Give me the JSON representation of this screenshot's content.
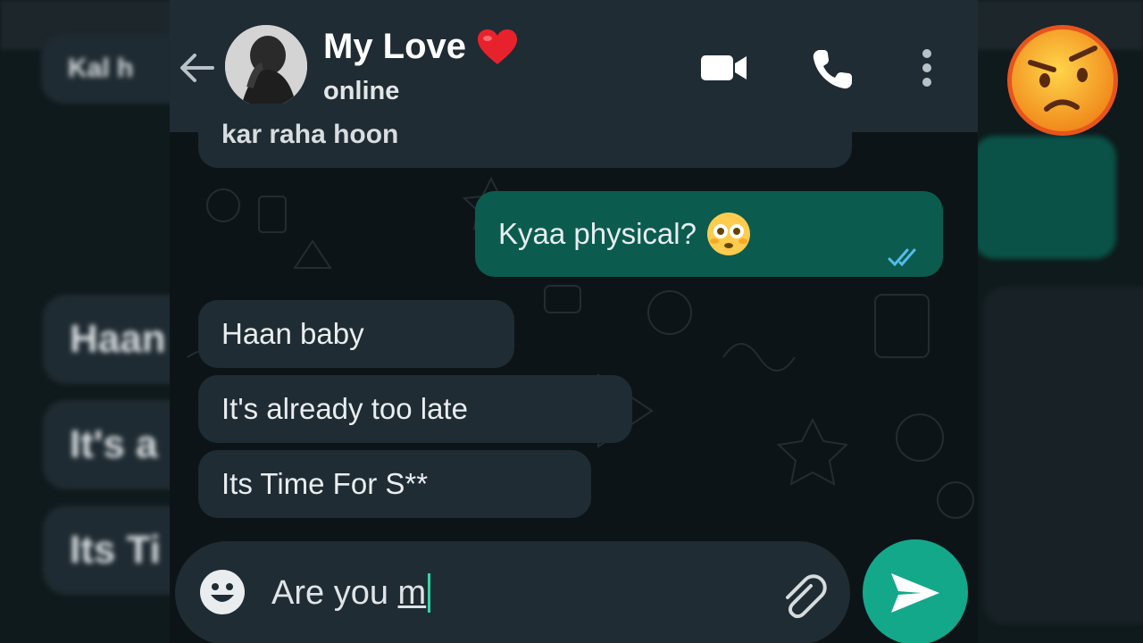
{
  "header": {
    "contact_name": "My Love",
    "status": "online"
  },
  "messages": [
    {
      "direction": "in",
      "text": "kar raha hoon"
    },
    {
      "direction": "out",
      "text": "Kyaa physical?",
      "emoji": "flushed-face",
      "read": true
    },
    {
      "direction": "in",
      "text": "Haan baby"
    },
    {
      "direction": "in",
      "text": "It's already too late"
    },
    {
      "direction": "in",
      "text": "Its Time For S**"
    }
  ],
  "composer": {
    "typed_prefix": "Are you ",
    "typed_tail": "m"
  },
  "background": {
    "blurred_top": "Kal h",
    "blurred_1": "Haan",
    "blurred_2": "It's a",
    "blurred_3": "Its Ti"
  },
  "colors": {
    "incoming_bubble": "#1f2c33",
    "outgoing_bubble": "#0b5c4f",
    "send_button": "#14a88a",
    "header": "#1f2c33",
    "read_ticks": "#53bdeb"
  },
  "icons": [
    "back-arrow-icon",
    "video-call-icon",
    "phone-call-icon",
    "more-options-icon",
    "emoji-icon",
    "attach-icon",
    "send-icon",
    "heart-emoji",
    "flushed-face-emoji",
    "annoyed-face-emoji"
  ]
}
